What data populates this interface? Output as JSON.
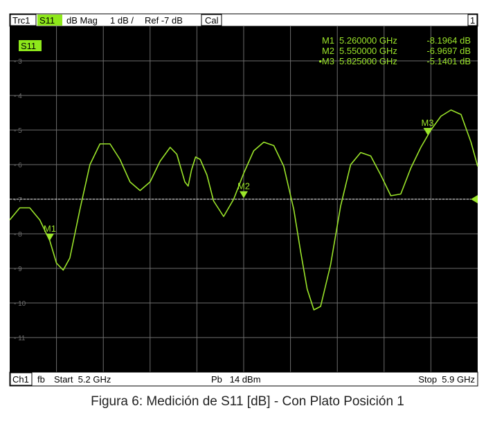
{
  "header": {
    "trace": "Trc1",
    "param": "S11",
    "format": "dB Mag",
    "scale": "1 dB /",
    "ref": "Ref -7 dB",
    "cal": "Cal",
    "channel_number": "1"
  },
  "footer": {
    "channel": "Ch1",
    "fb": "fb",
    "start": "Start  5.2 GHz",
    "power": "Pb   14 dBm",
    "stop": "Stop  5.9 GHz"
  },
  "trace_badge": "S11",
  "marker_readout": [
    {
      "prefix": "",
      "name": "M1",
      "freq": "5.260000 GHz",
      "val": "-8.1964 dB"
    },
    {
      "prefix": "",
      "name": "M2",
      "freq": "5.550000 GHz",
      "val": "-6.9697 dB"
    },
    {
      "prefix": "•",
      "name": "M3",
      "freq": "5.825000 GHz",
      "val": "-5.1401 dB"
    }
  ],
  "caption": "Figura 6: Medición de S11 [dB] - Con Plato Posición 1",
  "colors": {
    "background": "#000000",
    "trace": "#9be52a",
    "grid": "#6e6e6e",
    "text": "#ffffff",
    "header_bar": "#ffffff",
    "highlight": "#8ee81b"
  },
  "chart_data": {
    "type": "line",
    "xlim": [
      5.2,
      5.9
    ],
    "ylim": [
      -12,
      -2
    ],
    "xunit": "GHz",
    "yunit": "dB",
    "yticks": [
      -3,
      -4,
      -5,
      -6,
      -7,
      -8,
      -9,
      -10,
      -11
    ],
    "ref_level": -7,
    "grid": true,
    "series": [
      {
        "name": "S11",
        "x": [
          5.2,
          5.215,
          5.23,
          5.245,
          5.26,
          5.27,
          5.28,
          5.29,
          5.305,
          5.32,
          5.335,
          5.35,
          5.365,
          5.38,
          5.395,
          5.41,
          5.425,
          5.44,
          5.45,
          5.462,
          5.467,
          5.472,
          5.478,
          5.485,
          5.495,
          5.505,
          5.52,
          5.535,
          5.55,
          5.565,
          5.58,
          5.595,
          5.61,
          5.625,
          5.635,
          5.645,
          5.655,
          5.665,
          5.68,
          5.695,
          5.71,
          5.725,
          5.74,
          5.755,
          5.77,
          5.785,
          5.8,
          5.815,
          5.83,
          5.845,
          5.86,
          5.875,
          5.89,
          5.9
        ],
        "y": [
          -7.6,
          -7.25,
          -7.25,
          -7.6,
          -8.2,
          -8.85,
          -9.05,
          -8.7,
          -7.3,
          -6.0,
          -5.4,
          -5.4,
          -5.85,
          -6.5,
          -6.75,
          -6.5,
          -5.9,
          -5.5,
          -5.7,
          -6.5,
          -6.62,
          -6.15,
          -5.78,
          -5.85,
          -6.3,
          -7.05,
          -7.5,
          -7.0,
          -6.25,
          -5.6,
          -5.35,
          -5.45,
          -6.05,
          -7.3,
          -8.5,
          -9.6,
          -10.2,
          -10.1,
          -8.9,
          -7.2,
          -6.0,
          -5.65,
          -5.75,
          -6.3,
          -6.9,
          -6.85,
          -6.1,
          -5.5,
          -5.0,
          -4.6,
          -4.42,
          -4.55,
          -5.35,
          -6.05
        ]
      }
    ],
    "markers": [
      {
        "name": "M1",
        "x": 5.26,
        "y": -8.1964
      },
      {
        "name": "M2",
        "x": 5.55,
        "y": -6.9697
      },
      {
        "name": "M3",
        "x": 5.825,
        "y": -5.1401
      }
    ]
  }
}
